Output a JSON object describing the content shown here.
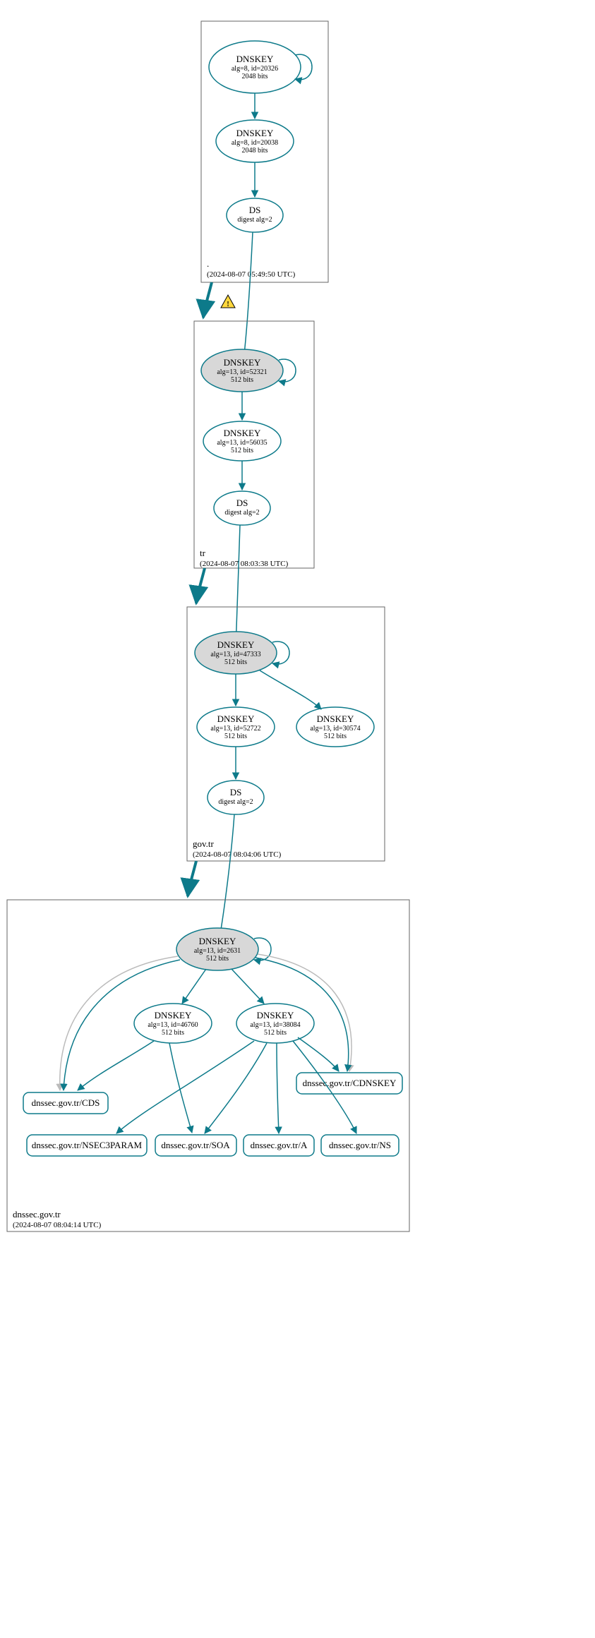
{
  "colors": {
    "teal": "#0d7a8a",
    "ksk_fill": "#d8d8d8",
    "light_edge": "#bbbbbb"
  },
  "zones": {
    "root": {
      "label": ".",
      "timestamp": "(2024-08-07 05:49:50 UTC)"
    },
    "tr": {
      "label": "tr",
      "timestamp": "(2024-08-07 08:03:38 UTC)"
    },
    "govtr": {
      "label": "gov.tr",
      "timestamp": "(2024-08-07 08:04:06 UTC)"
    },
    "dnssec": {
      "label": "dnssec.gov.tr",
      "timestamp": "(2024-08-07 08:04:14 UTC)"
    }
  },
  "nodes": {
    "root_ksk": {
      "title": "DNSKEY",
      "line2": "alg=8, id=20326",
      "line3": "2048 bits"
    },
    "root_zsk": {
      "title": "DNSKEY",
      "line2": "alg=8, id=20038",
      "line3": "2048 bits"
    },
    "root_ds": {
      "title": "DS",
      "line2": "digest alg=2"
    },
    "tr_ksk": {
      "title": "DNSKEY",
      "line2": "alg=13, id=52321",
      "line3": "512 bits"
    },
    "tr_zsk": {
      "title": "DNSKEY",
      "line2": "alg=13, id=56035",
      "line3": "512 bits"
    },
    "tr_ds": {
      "title": "DS",
      "line2": "digest alg=2"
    },
    "gov_ksk": {
      "title": "DNSKEY",
      "line2": "alg=13, id=47333",
      "line3": "512 bits"
    },
    "gov_zsk": {
      "title": "DNSKEY",
      "line2": "alg=13, id=52722",
      "line3": "512 bits"
    },
    "gov_zsk2": {
      "title": "DNSKEY",
      "line2": "alg=13, id=30574",
      "line3": "512 bits"
    },
    "gov_ds": {
      "title": "DS",
      "line2": "digest alg=2"
    },
    "dn_ksk": {
      "title": "DNSKEY",
      "line2": "alg=13, id=2631",
      "line3": "512 bits"
    },
    "dn_zsk1": {
      "title": "DNSKEY",
      "line2": "alg=13, id=46760",
      "line3": "512 bits"
    },
    "dn_zsk2": {
      "title": "DNSKEY",
      "line2": "alg=13, id=38084",
      "line3": "512 bits"
    },
    "rr_cds": {
      "label": "dnssec.gov.tr/CDS"
    },
    "rr_nsec3param": {
      "label": "dnssec.gov.tr/NSEC3PARAM"
    },
    "rr_soa": {
      "label": "dnssec.gov.tr/SOA"
    },
    "rr_a": {
      "label": "dnssec.gov.tr/A"
    },
    "rr_ns": {
      "label": "dnssec.gov.tr/NS"
    },
    "rr_cdnskey": {
      "label": "dnssec.gov.tr/CDNSKEY"
    }
  }
}
